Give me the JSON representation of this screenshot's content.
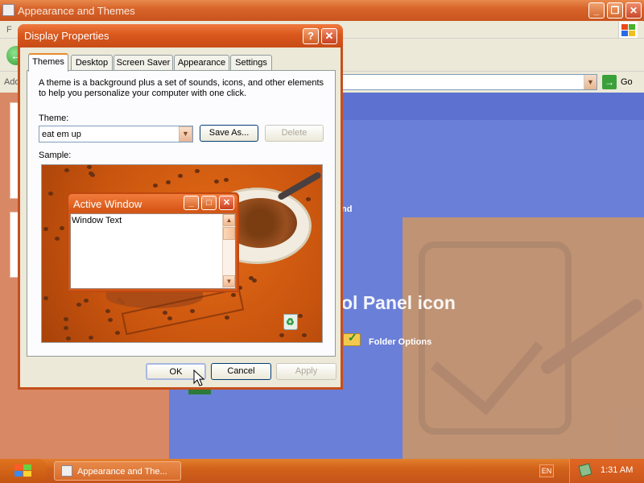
{
  "background_window": {
    "title": "Appearance and Themes",
    "menu_first_char": "F",
    "address_label": "Add",
    "go_label": "Go",
    "hidden_partial_text": "nd",
    "hidden_heading": "ol Panel icon",
    "folder_options_label": "Folder Options",
    "controls": {
      "minimize": "_",
      "restore": "❐",
      "close": "✕"
    }
  },
  "dialog": {
    "title": "Display Properties",
    "help_label": "?",
    "close_label": "✕",
    "tabs": [
      {
        "label": "Themes",
        "active": true
      },
      {
        "label": "Desktop",
        "active": false
      },
      {
        "label": "Screen Saver",
        "active": false
      },
      {
        "label": "Appearance",
        "active": false
      },
      {
        "label": "Settings",
        "active": false
      }
    ],
    "description": "A theme is a background plus a set of sounds, icons, and other elements to help you personalize your computer with one click.",
    "theme_label": "Theme:",
    "theme_value": "eat em up",
    "save_as_label": "Save As...",
    "delete_label": "Delete",
    "sample_label": "Sample:",
    "sample_window": {
      "title": "Active Window",
      "text": "Window Text",
      "controls": {
        "minimize": "_",
        "maximize": "□",
        "close": "✕"
      }
    },
    "ok_label": "OK",
    "cancel_label": "Cancel",
    "apply_label": "Apply"
  },
  "taskbar": {
    "task_label": "Appearance and The...",
    "language": "EN",
    "clock": "1:31 AM"
  },
  "colors": {
    "title_orange": "#d9581c",
    "desktop_blue": "#6a7fd8",
    "taskbar_orange": "#d1621a"
  },
  "icons": {
    "back": "back-arrow-icon",
    "go": "go-arrow-icon",
    "folder": "folder-options-icon",
    "recycle": "recycle-bin-icon",
    "start": "windows-flag-icon",
    "tray": "network-tray-icon"
  }
}
